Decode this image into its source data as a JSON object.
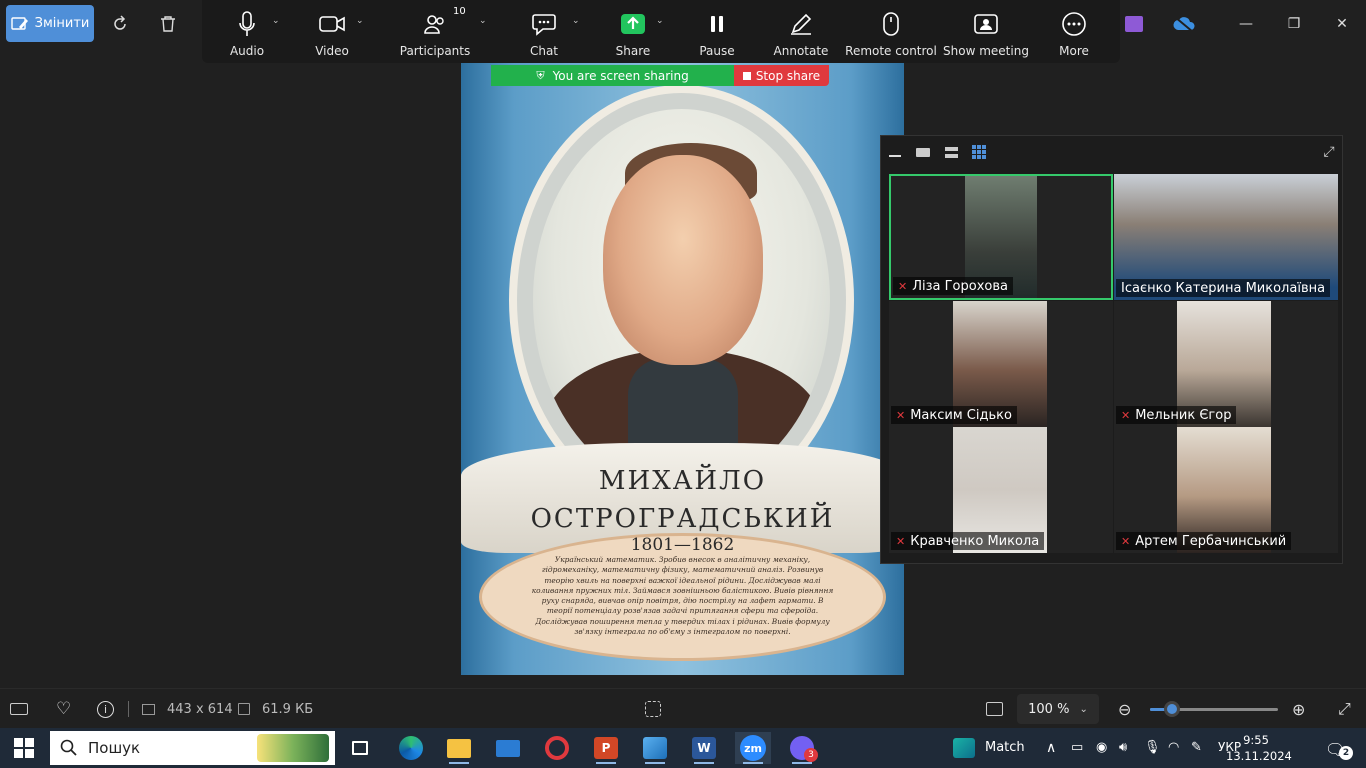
{
  "viewer": {
    "edit_label": "Змінити",
    "tools": [
      "rotate-icon",
      "delete-icon"
    ],
    "window_controls": [
      "minimize-icon",
      "restore-icon",
      "close-icon"
    ]
  },
  "zoom_toolbar": {
    "items": [
      {
        "label": "Audio",
        "icon": "microphone-icon"
      },
      {
        "label": "Video",
        "icon": "video-camera-icon"
      },
      {
        "label": "Participants",
        "icon": "participants-icon",
        "count": "10"
      },
      {
        "label": "Chat",
        "icon": "chat-icon"
      },
      {
        "label": "Share",
        "icon": "share-screen-icon"
      },
      {
        "label": "Pause",
        "icon": "pause-icon"
      },
      {
        "label": "Annotate",
        "icon": "pen-icon"
      },
      {
        "label": "Remote control",
        "icon": "mouse-icon"
      },
      {
        "label": "Show meeting",
        "icon": "show-meeting-icon"
      },
      {
        "label": "More",
        "icon": "more-icon"
      }
    ]
  },
  "share_banner": {
    "status": "You are screen sharing",
    "stop_label": "Stop share",
    "status_color": "#22b14c",
    "stop_color": "#e0393e"
  },
  "poster": {
    "name_line1": "МИХАЙЛО",
    "name_line2": "ОСТРОГРАДСЬКИЙ",
    "years": "1801—1862",
    "description": "Український математик. Зробив внесок в аналітичну механіку, гідромеханіку, математичну фізику, математичний аналіз. Розвинув теорію хвиль на поверхні важкої ідеальної рідини. Досліджував малі коливання пружних тіл. Займався зовнішньою балістикою. Вивів рівняння руху снаряда, вивчав опір повітря, дію пострілу на лафет гармати. В теорії потенціалу розв'язав задачі притягання сфери та сфероїда. Досліджував поширення тепла у твердих тілах і рідинах. Вивів формулу зв'язку інтеграла по об'єму з інтегралом по поверхні."
  },
  "gallery": {
    "view_modes": [
      "minimize-icon",
      "speaker-view-icon",
      "strip-view-icon",
      "gallery-view-icon"
    ],
    "participants": [
      {
        "name": "Ліза Горохова",
        "muted": true,
        "active": true
      },
      {
        "name": "Ісаєнко Катерина Миколаївна",
        "muted": false,
        "active": false
      },
      {
        "name": "Максим Сідько",
        "muted": true,
        "active": false
      },
      {
        "name": "Мельник Єгор",
        "muted": true,
        "active": false
      },
      {
        "name": "Кравченко Микола",
        "muted": true,
        "active": false
      },
      {
        "name": "Артем Гербачинський",
        "muted": true,
        "active": false
      }
    ]
  },
  "viewer_bottom": {
    "dimensions": "443 x 614",
    "file_size": "61.9 КБ",
    "zoom": "100 %",
    "zoom_slider_fraction": 0.17
  },
  "taskbar": {
    "search_placeholder": "Пошук",
    "weather": "Match",
    "language": "УКР",
    "time": "9:55",
    "date": "13.11.2024",
    "notifications": "2",
    "viber_badge": "3",
    "zoom_app_label": "zm",
    "word_app_label": "W",
    "powerpoint_app_label": "P"
  }
}
